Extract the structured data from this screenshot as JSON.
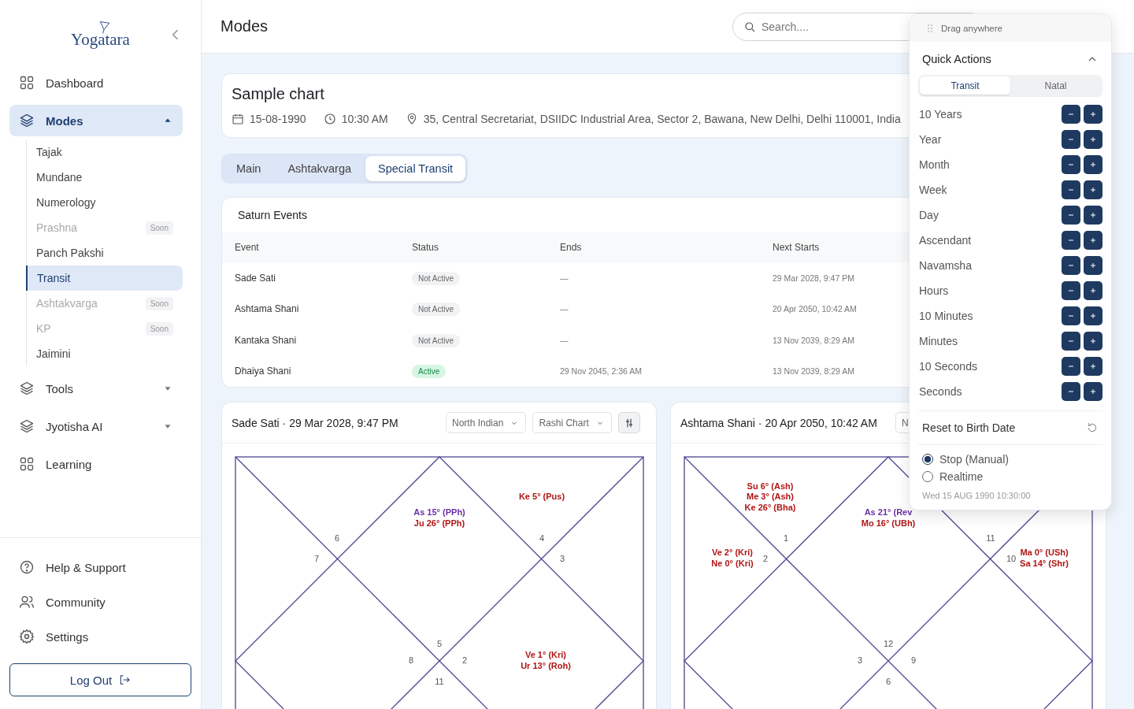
{
  "sidebar": {
    "logo": "Yogatara",
    "nav": [
      {
        "label": "Dashboard",
        "kind": "link",
        "selected": false
      },
      {
        "label": "Modes",
        "kind": "group",
        "selected": true,
        "expanded": true,
        "children": [
          {
            "label": "Tajak",
            "selected": false,
            "disabled": false
          },
          {
            "label": "Mundane",
            "selected": false,
            "disabled": false
          },
          {
            "label": "Numerology",
            "selected": false,
            "disabled": false
          },
          {
            "label": "Prashna",
            "selected": false,
            "disabled": true,
            "badge": "Soon"
          },
          {
            "label": "Panch Pakshi",
            "selected": false,
            "disabled": false
          },
          {
            "label": "Transit",
            "selected": true,
            "disabled": false
          },
          {
            "label": "Ashtakvarga",
            "selected": false,
            "disabled": true,
            "badge": "Soon"
          },
          {
            "label": "KP",
            "selected": false,
            "disabled": true,
            "badge": "Soon"
          },
          {
            "label": "Jaimini",
            "selected": false,
            "disabled": false
          }
        ]
      },
      {
        "label": "Tools",
        "kind": "group",
        "selected": false,
        "expanded": false
      },
      {
        "label": "Jyotisha AI",
        "kind": "group",
        "selected": false,
        "expanded": false
      },
      {
        "label": "Learning",
        "kind": "link",
        "selected": false
      }
    ],
    "footer": [
      "Help & Support",
      "Community",
      "Settings"
    ],
    "logout": "Log Out"
  },
  "header": {
    "title": "Modes",
    "search": {
      "placeholder": "Search...."
    }
  },
  "chart_info": {
    "title": "Sample chart",
    "date": "15-08-1990",
    "time": "10:30 AM",
    "place": "35, Central Secretariat, DSIIDC Industrial Area, Sector 2, Bawana, New Delhi, Delhi 110001, India"
  },
  "tabs": [
    {
      "label": "Main",
      "selected": false
    },
    {
      "label": "Ashtakvarga",
      "selected": false
    },
    {
      "label": "Special Transit",
      "selected": true
    }
  ],
  "saturn_events": {
    "title": "Saturn Events",
    "columns": [
      "Event",
      "Status",
      "Ends",
      "Next Starts"
    ],
    "rows": [
      {
        "event": "Sade Sati",
        "status": "Not Active",
        "active": false,
        "ends": "—",
        "next_starts": "29 Mar 2028, 9:47 PM"
      },
      {
        "event": "Ashtama Shani",
        "status": "Not Active",
        "active": false,
        "ends": "—",
        "next_starts": "20 Apr 2050, 10:42 AM"
      },
      {
        "event": "Kantaka Shani",
        "status": "Not Active",
        "active": false,
        "ends": "—",
        "next_starts": "13 Nov 2039, 8:29 AM"
      },
      {
        "event": "Dhaiya Shani",
        "status": "Active",
        "active": true,
        "ends": "29 Nov 2045, 2:36 AM",
        "next_starts": "13 Nov 2039, 8:29 AM"
      }
    ]
  },
  "chart_cards": [
    {
      "title": "Sade Sati · 29 Mar 2028, 9:47 PM",
      "selects": [
        "North Indian",
        "Rashi Chart"
      ],
      "settings_button": true,
      "houses": [
        {
          "sign": "6"
        },
        {
          "sign": "4",
          "planets": [
            {
              "text": "Ke 5° (Pus)",
              "kind": "planet"
            }
          ]
        },
        {
          "sign": "7"
        },
        {
          "sign": "3"
        },
        {
          "sign": "5",
          "planets": [
            {
              "text": "As 15° (PPh)",
              "kind": "ascendant"
            },
            {
              "text": "Ju 26° (PPh)",
              "kind": "planet"
            }
          ]
        },
        {
          "sign": "8"
        },
        {
          "sign": "2",
          "planets": [
            {
              "text": "Ve 1° (Kri)",
              "kind": "planet"
            },
            {
              "text": "Ur 13° (Roh)",
              "kind": "planet"
            }
          ]
        },
        {
          "sign": "11"
        }
      ]
    },
    {
      "title": "Ashtama Shani · 20 Apr 2050, 10:42 AM",
      "selects": [
        "N"
      ],
      "houses": [
        {
          "sign": "1",
          "planets": [
            {
              "text": "Su 6° (Ash)",
              "kind": "planet"
            },
            {
              "text": "Me 3° (Ash)",
              "kind": "planet"
            },
            {
              "text": "Ke 26° (Bha)",
              "kind": "planet"
            }
          ]
        },
        {
          "sign": "11"
        },
        {
          "sign": "2",
          "planets": [
            {
              "text": "Ve 2° (Kri)",
              "kind": "planet"
            },
            {
              "text": "Ne 0° (Kri)",
              "kind": "planet"
            }
          ]
        },
        {
          "sign": "10",
          "planets": [
            {
              "text": "Ma 0° (USh)",
              "kind": "planet"
            },
            {
              "text": "Sa 14° (Shr)",
              "kind": "planet"
            }
          ]
        },
        {
          "sign": "12",
          "planets": [
            {
              "text": "As 21° (Rev",
              "kind": "ascendant"
            },
            {
              "text": "Mo 16° (UBh)",
              "kind": "planet"
            }
          ]
        },
        {
          "sign": "3"
        },
        {
          "sign": "9"
        },
        {
          "sign": "6"
        }
      ]
    }
  ],
  "quick_actions": {
    "drag_label": "Drag anywhere",
    "title": "Quick Actions",
    "expanded": true,
    "modes": [
      {
        "label": "Transit",
        "selected": true
      },
      {
        "label": "Natal",
        "selected": false
      }
    ],
    "steps": [
      "10 Years",
      "Year",
      "Month",
      "Week",
      "Day",
      "Ascendant",
      "Navamsha",
      "Hours",
      "10 Minutes",
      "Minutes",
      "10 Seconds",
      "Seconds"
    ],
    "reset": "Reset to Birth Date",
    "run_modes": [
      {
        "label": "Stop (Manual)",
        "selected": true
      },
      {
        "label": "Realtime",
        "selected": false
      }
    ],
    "timestamp": "Wed 15 AUG 1990 10:30:00"
  }
}
